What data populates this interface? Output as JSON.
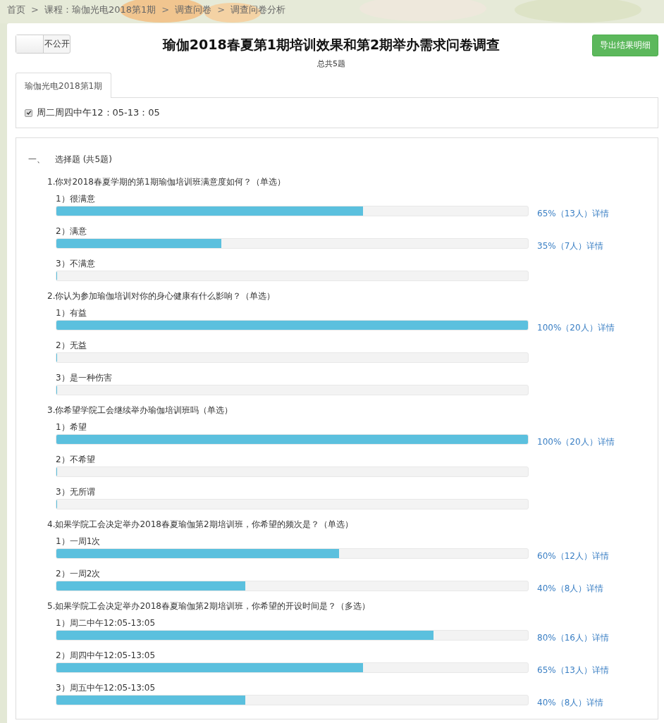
{
  "breadcrumb": {
    "separator": ">",
    "items": [
      "首页",
      "课程：瑜伽光电2018第1期",
      "调查问卷",
      "调查问卷分析"
    ]
  },
  "header": {
    "toggle": {
      "label": "不公开",
      "on": false
    },
    "title": "瑜伽2018春夏第1期培训效果和第2期举办需求问卷调查",
    "subtitle": "总共5题",
    "export_button": "导出结果明细"
  },
  "tabs": [
    {
      "label": "瑜伽光电2018第1期",
      "selected": true
    }
  ],
  "sessions": [
    {
      "label": "周二周四中午12：05-13：05",
      "checked": true
    }
  ],
  "section": {
    "number": "一、",
    "title": "选择题 (共5题)"
  },
  "questions": [
    {
      "title": "1.你对2018春夏学期的第1期瑜伽培训班满意度如何？（单选）",
      "options": [
        {
          "label": "1）很满意",
          "level": 0.65,
          "result": "65%（13人）详情"
        },
        {
          "label": "2）满意",
          "level": 0.35,
          "result": "35%（7人）详情"
        },
        {
          "label": "3）不满意",
          "level": 0
        }
      ]
    },
    {
      "title": "2.你认为参加瑜伽培训对你的身心健康有什么影响？（单选）",
      "options": [
        {
          "label": "1）有益",
          "level": 1,
          "result": "100%（20人）详情"
        },
        {
          "label": "2）无益",
          "level": 0
        },
        {
          "label": "3）是一种伤害",
          "level": 0
        }
      ]
    },
    {
      "title": "3.你希望学院工会继续举办瑜伽培训班吗（单选）",
      "options": [
        {
          "label": "1）希望",
          "level": 1,
          "result": "100%（20人）详情"
        },
        {
          "label": "2）不希望",
          "level": 0
        },
        {
          "label": "3）无所谓",
          "level": 0
        }
      ]
    },
    {
      "title": "4.如果学院工会决定举办2018春夏瑜伽第2期培训班，你希望的频次是？（单选）",
      "options": [
        {
          "label": "1）一周1次",
          "level": 0.6,
          "result": "60%（12人）详情"
        },
        {
          "label": "2）一周2次",
          "level": 0.4,
          "result": "40%（8人）详情"
        }
      ]
    },
    {
      "title": "5.如果学院工会决定举办2018春夏瑜伽第2期培训班，你希望的开设时间是？（多选）",
      "options": [
        {
          "label": "1）周二中午12:05-13:05",
          "level": 0.8,
          "result": "80%（16人）详情"
        },
        {
          "label": "2）周四中午12:05-13:05",
          "level": 0.65,
          "result": "65%（13人）详情"
        },
        {
          "label": "3）周五中午12:05-13:05",
          "level": 0.4,
          "result": "40%（8人）详情"
        }
      ]
    }
  ]
}
